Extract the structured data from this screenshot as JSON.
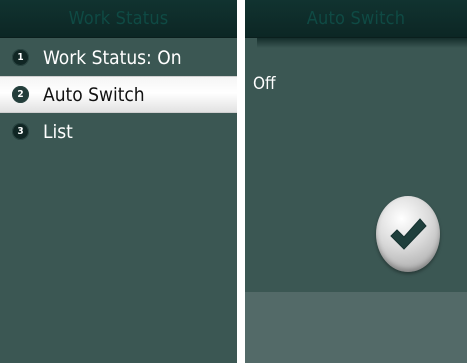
{
  "left_screen": {
    "title": "Work Status",
    "items": [
      {
        "number": "1",
        "label": "Work Status: On"
      },
      {
        "number": "2",
        "label": "Auto Switch"
      },
      {
        "number": "3",
        "label": "List"
      }
    ]
  },
  "right_screen": {
    "title": "Auto Switch",
    "value": "Off",
    "confirm_icon": "checkmark-icon"
  },
  "colors": {
    "background": "#3b5753",
    "titlebar": "#0c2624",
    "selected_row": "#ffffff",
    "check_color": "#1f3f3c"
  }
}
